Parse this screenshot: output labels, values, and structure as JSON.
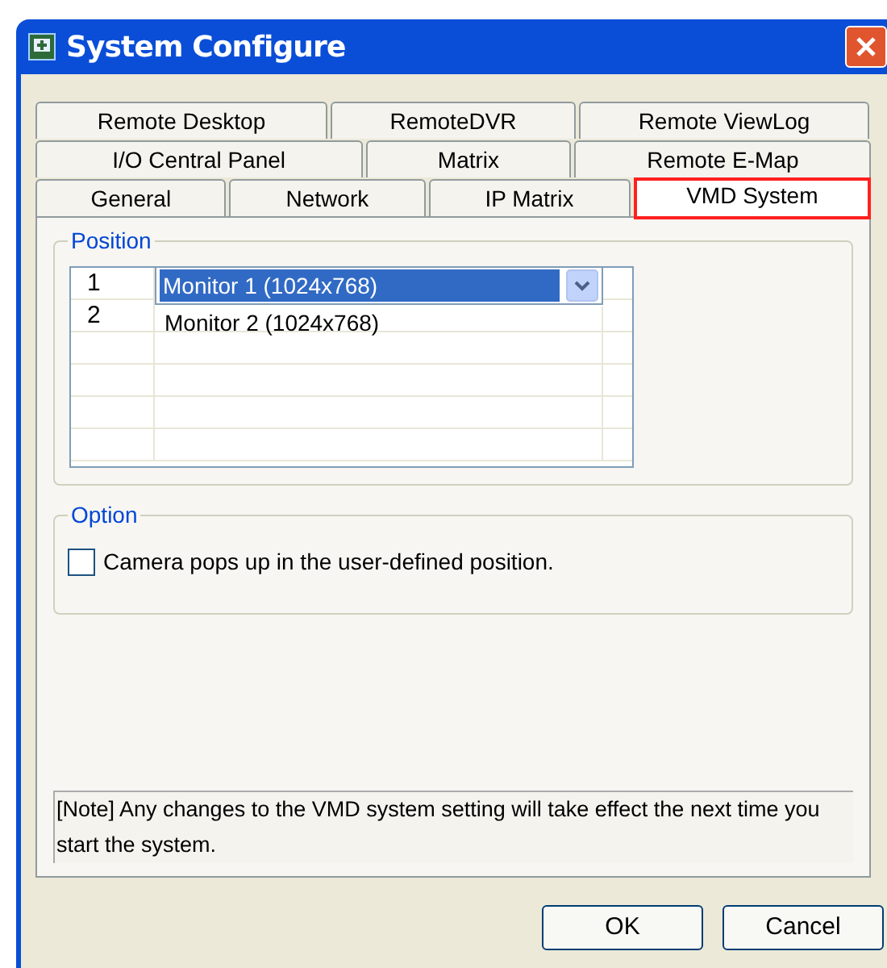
{
  "window": {
    "title": "System Configure"
  },
  "tab_rows": [
    [
      {
        "label": "Remote Desktop",
        "selected": false
      },
      {
        "label": "RemoteDVR",
        "selected": false
      },
      {
        "label": "Remote ViewLog",
        "selected": false
      }
    ],
    [
      {
        "label": "I/O Central Panel",
        "selected": false
      },
      {
        "label": "Matrix",
        "selected": false
      },
      {
        "label": "Remote E-Map",
        "selected": false
      }
    ],
    [
      {
        "label": "General",
        "selected": false
      },
      {
        "label": "Network",
        "selected": false
      },
      {
        "label": "IP Matrix",
        "selected": false
      },
      {
        "label": "VMD System",
        "selected": true
      }
    ]
  ],
  "position": {
    "title": "Position",
    "rows": [
      {
        "number": "1",
        "monitor": "Monitor 1  (1024x768)",
        "editing": true
      },
      {
        "number": "2",
        "monitor": "Monitor 2 (1024x768)",
        "editing": false
      }
    ]
  },
  "option": {
    "title": "Option",
    "checkbox": {
      "label": "Camera pops up in the user-defined position.",
      "checked": false
    }
  },
  "note": "[Note]  Any changes to the VMD system setting will take effect the next time you start the system.",
  "buttons": [
    "OK",
    "Cancel"
  ]
}
